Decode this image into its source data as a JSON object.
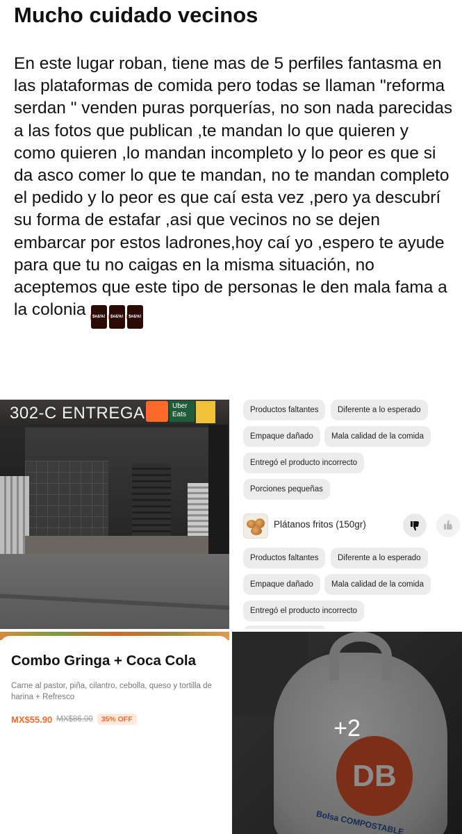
{
  "post": {
    "title": "Mucho cuidado vecinos",
    "body": "En este lugar roban, tiene mas de 5 perfiles fantasma en las plataformas de comida pero todas se llaman \"reforma serdan \" venden puras porquerías, no son nada parecidas a las fotos que publican ,te mandan lo que quieren y como quieren ,lo mandan incompleto y lo peor es que si da asco comer lo que te mandan, no te mandan completo el pedido y lo peor es que caí esta vez ,pero ya descubrí su forma de estafar ,asi que vecinos no se dejen embarcar por estos ladrones,hoy caí yo ,espero te ayude para que tu no caigas en la misma situación, no aceptemos que este tipo de personas le den mala fama a la colonia",
    "emoji": [
      "angry-swearing-face-icon",
      "angry-swearing-face-icon",
      "angry-swearing-face-icon"
    ],
    "emoji_text": "$#&%!"
  },
  "storefront": {
    "sign_text": "302-C ENTREGAS",
    "uber_label": "Uber Eats"
  },
  "complaint": {
    "chips_top": [
      "Productos faltantes",
      "Diferente a lo esperado",
      "Empaque dañado",
      "Mala calidad de la comida",
      "Entregó el producto incorrecto",
      "Porciones pequeñas"
    ],
    "product_name": "Plátanos fritos (150gr)",
    "chips_bottom": [
      "Productos faltantes",
      "Diferente a lo esperado",
      "Empaque dañado",
      "Mala calidad de la comida",
      "Entregó el producto incorrecto"
    ]
  },
  "product_card": {
    "title": "Combo Gringa + Coca Cola",
    "description": "Carne al pastor, piña, cilantro, cebolla, queso y tortilla de harina + Refresco",
    "price_now": "MX$55.90",
    "price_old": "MX$86.00",
    "discount": "35% OFF"
  },
  "bag_photo": {
    "logo_text": "DB",
    "bag_text": "Bolsa COMPOSTABLE",
    "more_count": "+2"
  },
  "colors": {
    "accent_orange": "#ff6a2b",
    "chip_bg": "#ececec",
    "text": "#111111"
  }
}
